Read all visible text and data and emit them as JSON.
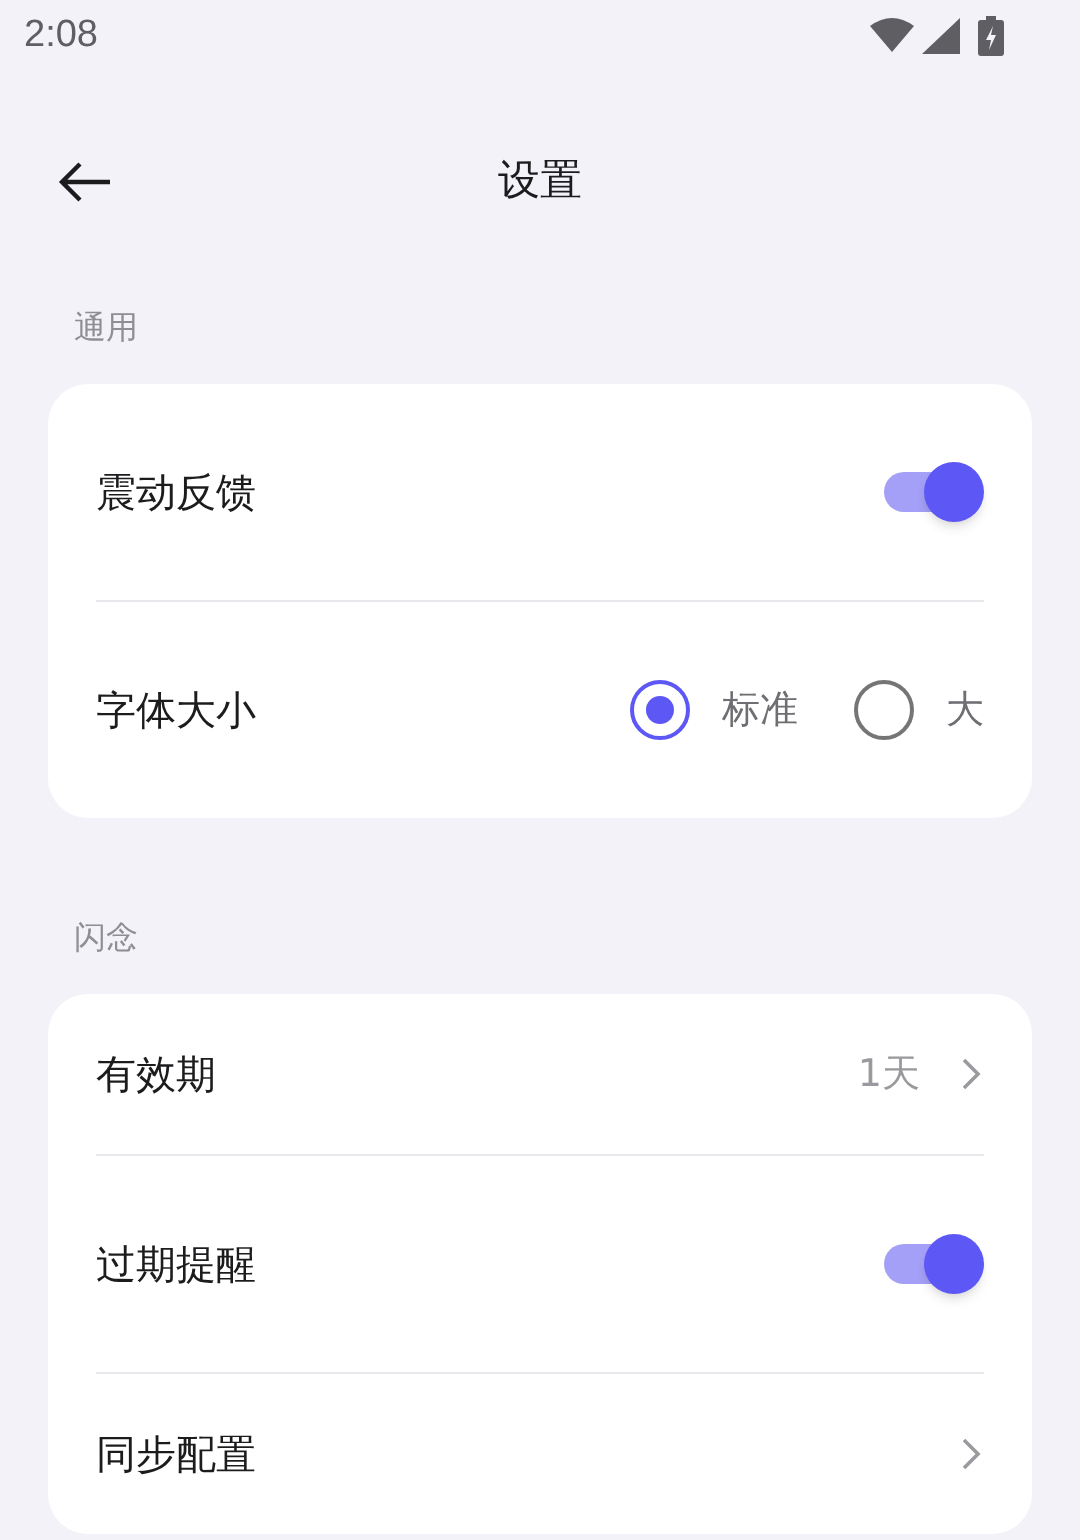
{
  "status_bar": {
    "time": "2:08"
  },
  "header": {
    "title": "设置"
  },
  "sections": [
    {
      "title": "通用",
      "items": [
        {
          "kind": "toggle",
          "label": "震动反馈",
          "on": true
        },
        {
          "kind": "radio",
          "label": "字体大小",
          "options": [
            {
              "label": "标准",
              "selected": true
            },
            {
              "label": "大",
              "selected": false
            }
          ]
        }
      ]
    },
    {
      "title": "闪念",
      "items": [
        {
          "kind": "link",
          "label": "有效期",
          "value": "1天"
        },
        {
          "kind": "toggle",
          "label": "过期提醒",
          "on": true
        },
        {
          "kind": "link",
          "label": "同步配置"
        }
      ]
    }
  ]
}
